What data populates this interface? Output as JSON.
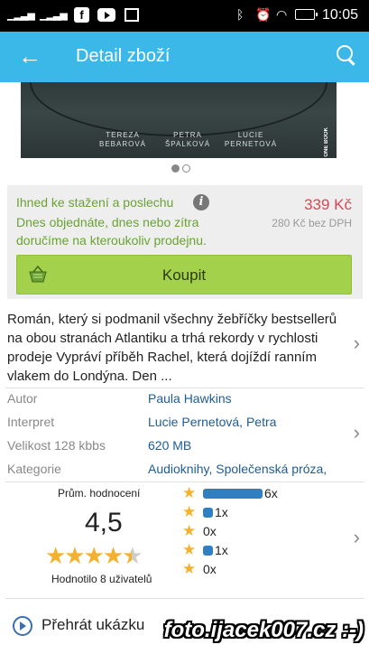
{
  "status_bar": {
    "time": "10:05",
    "left_icons": [
      "signal-icon",
      "signal-icon",
      "facebook-icon",
      "youtube-icon",
      "image-icon"
    ],
    "right_icons": [
      "bluetooth-icon",
      "alarm-icon",
      "wifi-icon",
      "battery-icon"
    ]
  },
  "app_bar": {
    "title": "Detail zboží",
    "back_icon": "arrow-left-icon",
    "search_icon": "search-icon"
  },
  "cover": {
    "authors": [
      "TEREZA\nBEBAROVÁ",
      "PETRA\nŠPALKOVÁ",
      "LUCIE\nPERNETOVÁ"
    ],
    "publisher": "ONE BOOK"
  },
  "carousel": {
    "pages": 2,
    "active": 1
  },
  "purchase": {
    "availability": "Ihned ke stažení a poslechu",
    "delivery": "Dnes objednáte, dnes nebo zítra doručíme na kteroukoliv prodejnu.",
    "price": "339 Kč",
    "price_net": "280 Kč bez DPH",
    "buy_label": "Koupit"
  },
  "description": "Román, který si podmanil všechny žebříčky bestsellerů na obou stranách Atlantiku a trhá rekordy v rychlosti prodeje Vypráví příběh Rachel, která dojíždí ranním vlakem do Londýna. Den ...",
  "details": [
    {
      "label": "Autor",
      "value": "Paula Hawkins"
    },
    {
      "label": "Interpret",
      "value": "Lucie Pernetová, Petra"
    },
    {
      "label": "Velikost 128 kbbs",
      "value": "620 MB"
    },
    {
      "label": "Kategorie",
      "value": "Audioknihy, Společenská próza,"
    }
  ],
  "rating": {
    "title": "Prům. hodnocení",
    "value": "4,5",
    "stars": 4.5,
    "count_text": "Hodnotilo 8 uživatelů",
    "distribution": [
      {
        "count": 6,
        "label": "6x"
      },
      {
        "count": 1,
        "label": "1x"
      },
      {
        "count": 0,
        "label": "0x"
      },
      {
        "count": 1,
        "label": "1x"
      },
      {
        "count": 0,
        "label": "0x"
      }
    ]
  },
  "play_label": "Přehrát ukázku",
  "watermark": "foto.ijacek007.cz :-)",
  "colors": {
    "app_bar": "#3bb8e8",
    "buy_button": "#a3d14c",
    "price": "#d84653",
    "availability": "#6aa233",
    "link": "#1f5c95",
    "star": "#f3b12c",
    "bar": "#2f7fc1"
  }
}
